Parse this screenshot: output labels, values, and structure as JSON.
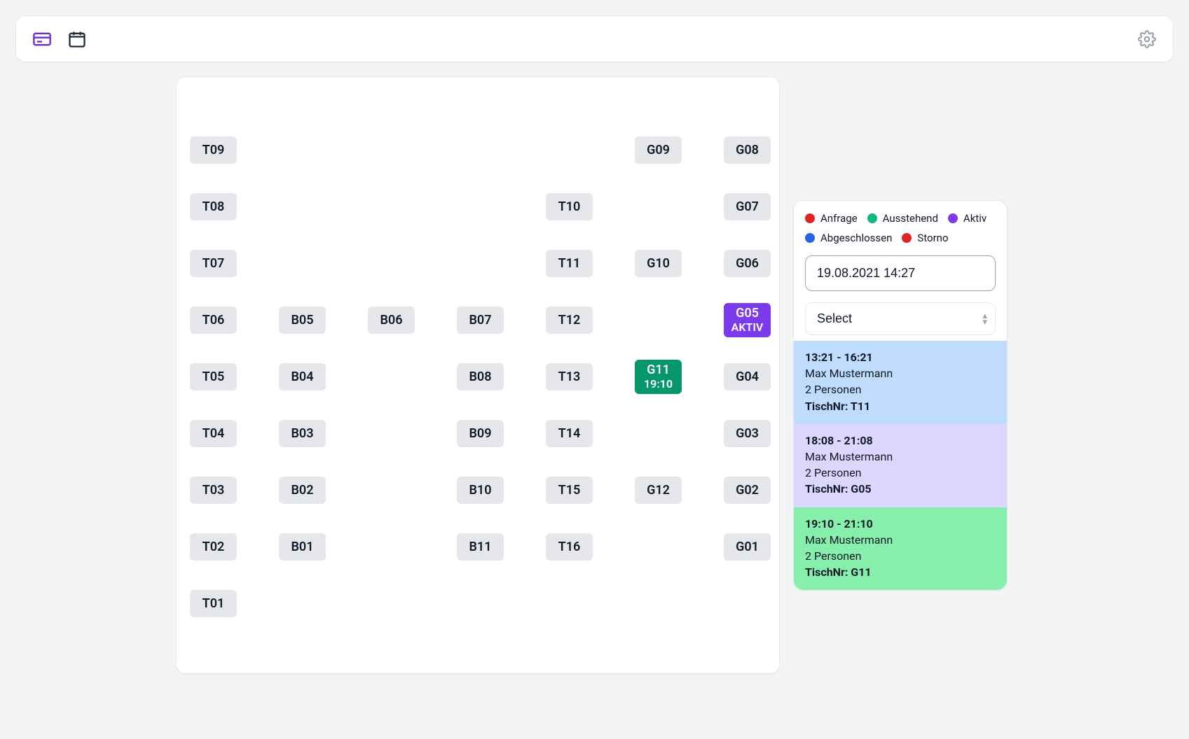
{
  "topbar": {
    "view_icons": [
      "card-view-icon",
      "calendar-icon"
    ],
    "settings_icon": "gear-icon"
  },
  "floor": {
    "tiles": [
      {
        "id": "T09",
        "col": 0,
        "row": 0
      },
      {
        "id": "G09",
        "col": 5,
        "row": 0
      },
      {
        "id": "G08",
        "col": 6,
        "row": 0
      },
      {
        "id": "T08",
        "col": 0,
        "row": 1
      },
      {
        "id": "T10",
        "col": 4,
        "row": 1
      },
      {
        "id": "G07",
        "col": 6,
        "row": 1
      },
      {
        "id": "T07",
        "col": 0,
        "row": 2
      },
      {
        "id": "T11",
        "col": 4,
        "row": 2
      },
      {
        "id": "G10",
        "col": 5,
        "row": 2
      },
      {
        "id": "G06",
        "col": 6,
        "row": 2
      },
      {
        "id": "T06",
        "col": 0,
        "row": 3
      },
      {
        "id": "B05",
        "col": 1,
        "row": 3
      },
      {
        "id": "B06",
        "col": 2,
        "row": 3
      },
      {
        "id": "B07",
        "col": 3,
        "row": 3
      },
      {
        "id": "T12",
        "col": 4,
        "row": 3
      },
      {
        "id": "G05",
        "col": 6,
        "row": 3,
        "status": "aktiv",
        "sub": "AKTIV"
      },
      {
        "id": "T05",
        "col": 0,
        "row": 4
      },
      {
        "id": "B04",
        "col": 1,
        "row": 4
      },
      {
        "id": "B08",
        "col": 3,
        "row": 4
      },
      {
        "id": "T13",
        "col": 4,
        "row": 4
      },
      {
        "id": "G11",
        "col": 5,
        "row": 4,
        "status": "ausstehend",
        "sub": "19:10"
      },
      {
        "id": "G04",
        "col": 6,
        "row": 4
      },
      {
        "id": "T04",
        "col": 0,
        "row": 5
      },
      {
        "id": "B03",
        "col": 1,
        "row": 5
      },
      {
        "id": "B09",
        "col": 3,
        "row": 5
      },
      {
        "id": "T14",
        "col": 4,
        "row": 5
      },
      {
        "id": "G03",
        "col": 6,
        "row": 5
      },
      {
        "id": "T03",
        "col": 0,
        "row": 6
      },
      {
        "id": "B02",
        "col": 1,
        "row": 6
      },
      {
        "id": "B10",
        "col": 3,
        "row": 6
      },
      {
        "id": "T15",
        "col": 4,
        "row": 6
      },
      {
        "id": "G12",
        "col": 5,
        "row": 6
      },
      {
        "id": "G02",
        "col": 6,
        "row": 6
      },
      {
        "id": "T02",
        "col": 0,
        "row": 7
      },
      {
        "id": "B01",
        "col": 1,
        "row": 7
      },
      {
        "id": "B11",
        "col": 3,
        "row": 7
      },
      {
        "id": "T16",
        "col": 4,
        "row": 7
      },
      {
        "id": "G01",
        "col": 6,
        "row": 7
      },
      {
        "id": "T01",
        "col": 0,
        "row": 8
      }
    ],
    "layout": {
      "tileW": 67,
      "tileH": 39,
      "colStep": 127,
      "rowStep": 81
    }
  },
  "sidebar": {
    "legend": [
      {
        "label": "Anfrage",
        "color": "#DC2626"
      },
      {
        "label": "Ausstehend",
        "color": "#10B981"
      },
      {
        "label": "Aktiv",
        "color": "#7C3AED"
      },
      {
        "label": "Abgeschlossen",
        "color": "#2563EB"
      },
      {
        "label": "Storno",
        "color": "#DC2626"
      }
    ],
    "datetime": "19.08.2021 14:27",
    "select_placeholder": "Select",
    "reservations": [
      {
        "time": "13:21 - 16:21",
        "name": "Max Mustermann",
        "persons": "2 Personen",
        "tisch_label": "TischNr: ",
        "tisch": "T11",
        "status": "completed"
      },
      {
        "time": "18:08 - 21:08",
        "name": "Max Mustermann",
        "persons": "2 Personen",
        "tisch_label": "TischNr: ",
        "tisch": "G05",
        "status": "active"
      },
      {
        "time": "19:10 - 21:10",
        "name": "Max Mustermann",
        "persons": "2 Personen",
        "tisch_label": "TischNr: ",
        "tisch": "G11",
        "status": "pending"
      }
    ]
  }
}
